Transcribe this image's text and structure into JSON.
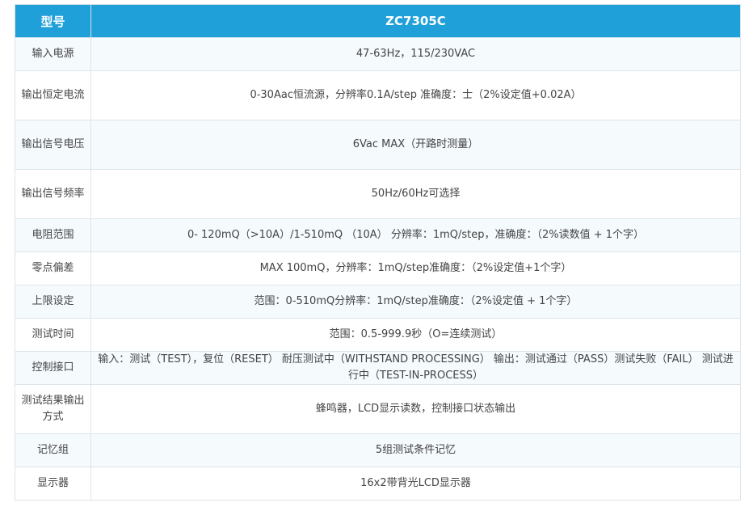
{
  "header": {
    "col1": "型号",
    "col2": "ZC7305C"
  },
  "rows": [
    {
      "label": "输入电源",
      "value": "47-63Hz，115/230VAC"
    },
    {
      "label": "输出恒定电流",
      "value": "0-30Aac恒流源，分辨率0.1A/step 准确度：士（2%设定值+0.02A）"
    },
    {
      "label": "输出信号电压",
      "value": "6Vac MAX（开路时测量）"
    },
    {
      "label": "输出信号频率",
      "value": "50Hz/60Hz可选择"
    },
    {
      "label": "电阻范围",
      "value": "0- 120mQ（>10A）/1-510mQ （10A） 分辨率：1mQ/step，准确度：（2%读数值 + 1个字）"
    },
    {
      "label": "零点偏差",
      "value": "MAX 100mQ，分辨率：1mQ/step准确度：（2%设定值+1个字）"
    },
    {
      "label": "上限设定",
      "value": "范围：0-510mQ分辨率：1mQ/step准确度：（2%设定值 + 1个字）"
    },
    {
      "label": "测试时间",
      "value": "范围：0.5-999.9秒（O=连续测试）"
    },
    {
      "label": "控制接口",
      "value": "输入：测试（TEST），复位（RESET） 耐压测试中（WITHSTAND PROCESSING） 输出：测试通过（PASS）测试失败（FAIL） 测试进行中（TEST-IN-PROCESS）"
    },
    {
      "label": "测试结果输出方式",
      "value": "蜂鸣器，LCD显示读数，控制接口状态输出"
    },
    {
      "label": "记忆组",
      "value": "5组测试条件记忆"
    },
    {
      "label": "显示器",
      "value": "16x2带背光LCD显示器"
    }
  ]
}
